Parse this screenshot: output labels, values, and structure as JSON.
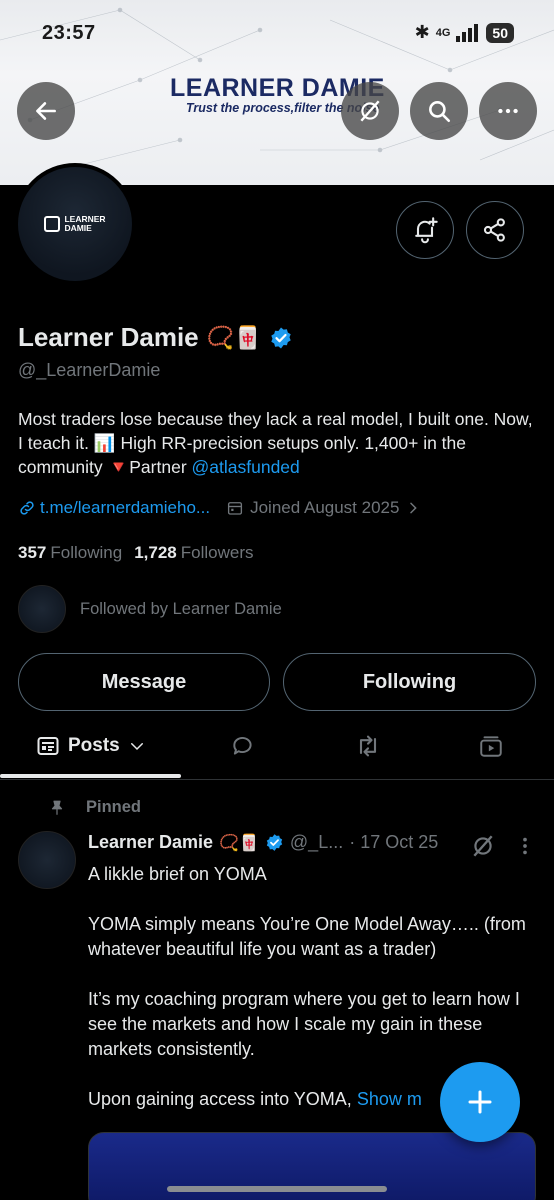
{
  "status_bar": {
    "time": "23:57",
    "network": "4G",
    "battery": "50"
  },
  "banner": {
    "title": "LEARNER DAMIE",
    "subtitle": "Trust the process,filter the noise"
  },
  "avatar": {
    "logo_text_1": "LEARNER",
    "logo_text_2": "DAMIE"
  },
  "profile": {
    "name": "Learner Damie",
    "name_emojis": "📿🀄",
    "handle": "@_LearnerDamie",
    "bio_text": "Most traders lose because they lack a real model, I built one. Now, I teach it. 📊 High RR-precision setups only. 1,400+ in the community 🔻Partner ",
    "bio_link": "@atlasfunded",
    "url": "t.me/learnerdamieho...",
    "joined": "Joined August 2025",
    "following_count": "357",
    "following_label": "Following",
    "followers_count": "1,728",
    "followers_label": "Followers",
    "followed_by": "Followed by Learner Damie"
  },
  "actions": {
    "message": "Message",
    "following": "Following"
  },
  "tabs": {
    "posts": "Posts"
  },
  "post": {
    "pinned_label": "Pinned",
    "author": "Learner Damie",
    "author_emojis": "📿🀄",
    "handle": "@_L...",
    "date": "· 17 Oct 25",
    "line1": "A likkle brief on YOMA",
    "para1": "YOMA simply means You’re One Model Away….. (from whatever beautiful life you want as a trader)",
    "para2": "It’s my coaching program where you get to learn how I see the markets and how I scale my gain in these markets consistently.",
    "para3": "Upon gaining access into YOMA, ",
    "show_more": "Show m"
  },
  "colors": {
    "accent": "#1d9bf0",
    "background": "#000000",
    "muted": "#71767b",
    "banner_text": "#1b2a63"
  },
  "icons": [
    "back-arrow-icon",
    "grok-icon",
    "search-icon",
    "more-icon",
    "bell-plus-icon",
    "share-icon",
    "verified-icon",
    "link-icon",
    "calendar-icon",
    "chevron-right-icon",
    "posts-icon",
    "chevron-down-icon",
    "replies-icon",
    "reposts-icon",
    "media-icon",
    "pin-icon",
    "more-vertical-icon",
    "plus-icon"
  ]
}
